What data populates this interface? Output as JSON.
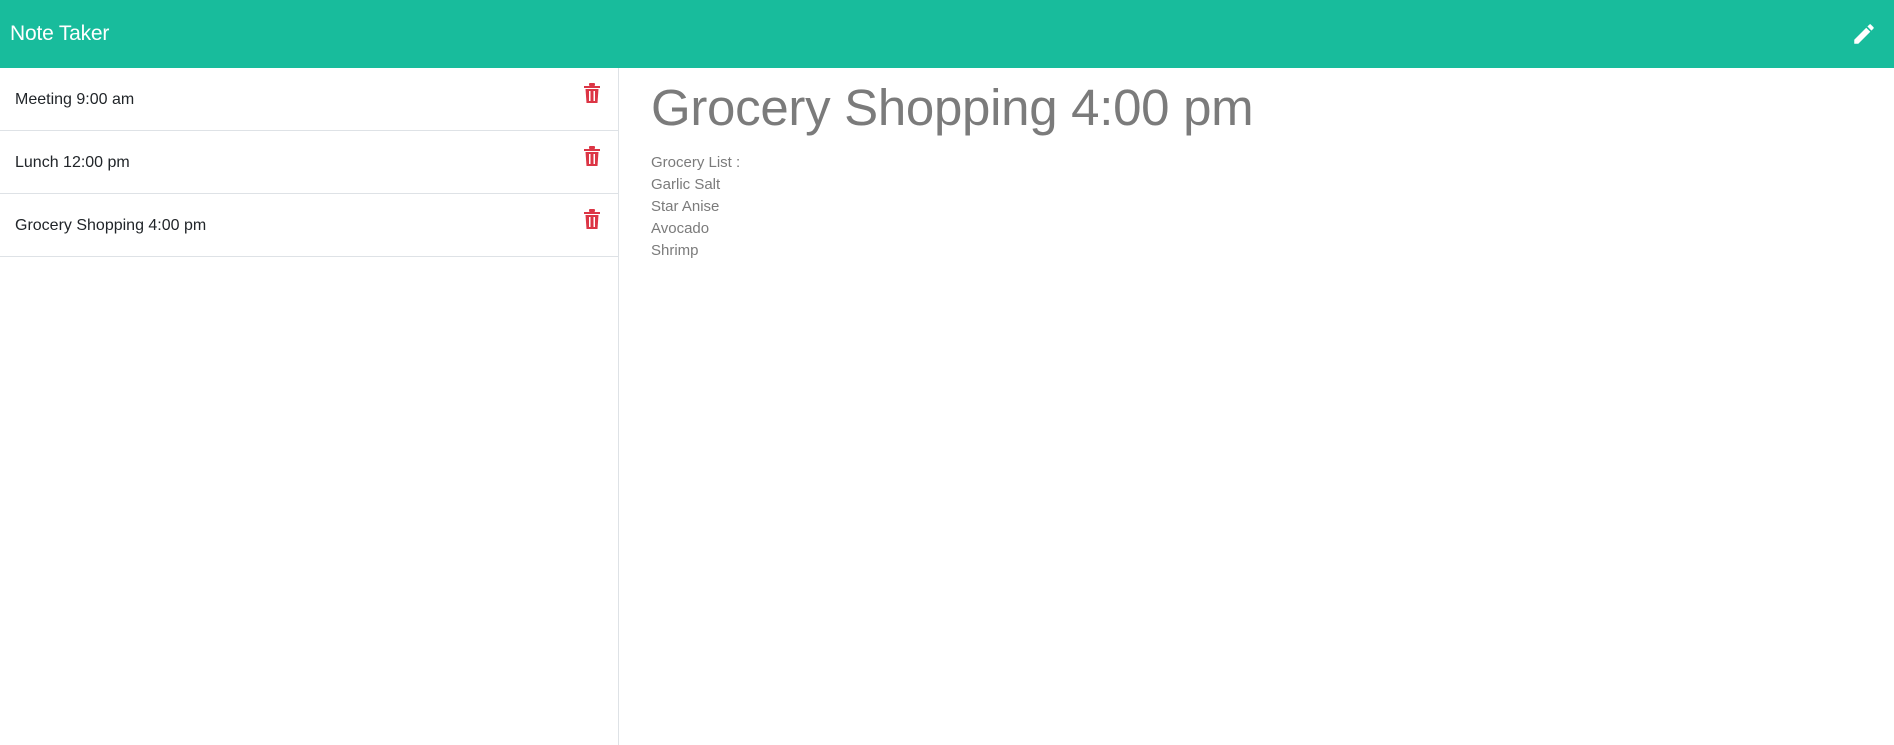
{
  "app": {
    "title": "Note Taker",
    "accent_color": "#18bc9c",
    "delete_color": "#dc3545"
  },
  "toolbar": {
    "new_note_icon": "pencil-icon"
  },
  "notes": [
    {
      "title": "Meeting 9:00 am",
      "delete_icon": "trash-icon"
    },
    {
      "title": "Lunch 12:00 pm",
      "delete_icon": "trash-icon"
    },
    {
      "title": "Grocery Shopping 4:00 pm",
      "delete_icon": "trash-icon"
    }
  ],
  "active_note": {
    "title": "Grocery Shopping 4:00 pm",
    "lines": [
      "Grocery List :",
      "Garlic Salt",
      "Star Anise",
      "Avocado",
      "Shrimp"
    ]
  }
}
